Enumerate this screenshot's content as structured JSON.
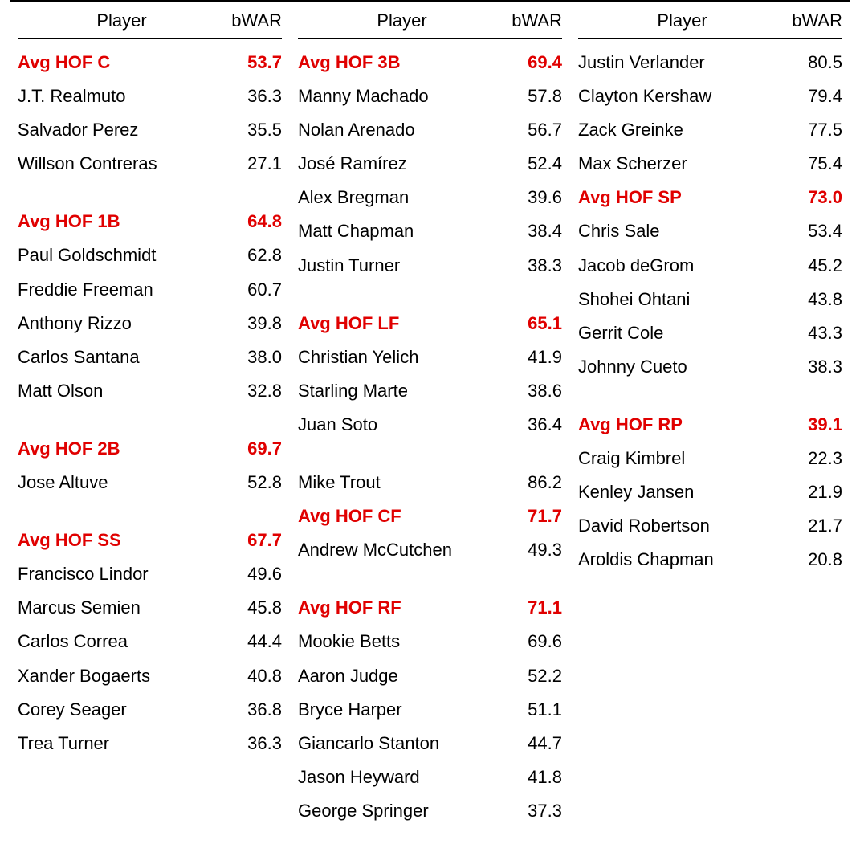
{
  "headers": {
    "player": "Player",
    "bwar": "bWAR"
  },
  "columns": [
    [
      {
        "type": "hof",
        "player": "Avg HOF C",
        "bwar": "53.7"
      },
      {
        "type": "row",
        "player": "J.T. Realmuto",
        "bwar": "36.3"
      },
      {
        "type": "row",
        "player": "Salvador Perez",
        "bwar": "35.5"
      },
      {
        "type": "row",
        "player": "Willson Contreras",
        "bwar": "27.1"
      },
      {
        "type": "spacer"
      },
      {
        "type": "hof",
        "player": "Avg HOF 1B",
        "bwar": "64.8"
      },
      {
        "type": "row",
        "player": "Paul Goldschmidt",
        "bwar": "62.8"
      },
      {
        "type": "row",
        "player": "Freddie Freeman",
        "bwar": "60.7"
      },
      {
        "type": "row",
        "player": "Anthony Rizzo",
        "bwar": "39.8"
      },
      {
        "type": "row",
        "player": "Carlos Santana",
        "bwar": "38.0"
      },
      {
        "type": "row",
        "player": "Matt Olson",
        "bwar": "32.8"
      },
      {
        "type": "spacer"
      },
      {
        "type": "hof",
        "player": "Avg HOF 2B",
        "bwar": "69.7"
      },
      {
        "type": "row",
        "player": "Jose Altuve",
        "bwar": "52.8"
      },
      {
        "type": "spacer"
      },
      {
        "type": "hof",
        "player": "Avg HOF SS",
        "bwar": "67.7"
      },
      {
        "type": "row",
        "player": "Francisco Lindor",
        "bwar": "49.6"
      },
      {
        "type": "row",
        "player": "Marcus Semien",
        "bwar": "45.8"
      },
      {
        "type": "row",
        "player": "Carlos Correa",
        "bwar": "44.4"
      },
      {
        "type": "row",
        "player": "Xander Bogaerts",
        "bwar": "40.8"
      },
      {
        "type": "row",
        "player": "Corey Seager",
        "bwar": "36.8"
      },
      {
        "type": "row",
        "player": "Trea Turner",
        "bwar": "36.3"
      }
    ],
    [
      {
        "type": "hof",
        "player": "Avg HOF 3B",
        "bwar": "69.4"
      },
      {
        "type": "row",
        "player": "Manny Machado",
        "bwar": "57.8"
      },
      {
        "type": "row",
        "player": "Nolan Arenado",
        "bwar": "56.7"
      },
      {
        "type": "row",
        "player": "José Ramírez",
        "bwar": "52.4"
      },
      {
        "type": "row",
        "player": "Alex Bregman",
        "bwar": "39.6"
      },
      {
        "type": "row",
        "player": "Matt Chapman",
        "bwar": "38.4"
      },
      {
        "type": "row",
        "player": "Justin Turner",
        "bwar": "38.3"
      },
      {
        "type": "spacer"
      },
      {
        "type": "hof",
        "player": "Avg HOF LF",
        "bwar": "65.1"
      },
      {
        "type": "row",
        "player": "Christian Yelich",
        "bwar": "41.9"
      },
      {
        "type": "row",
        "player": "Starling Marte",
        "bwar": "38.6"
      },
      {
        "type": "row",
        "player": "Juan Soto",
        "bwar": "36.4"
      },
      {
        "type": "spacer"
      },
      {
        "type": "row",
        "player": "Mike Trout",
        "bwar": "86.2"
      },
      {
        "type": "hof",
        "player": "Avg HOF CF",
        "bwar": "71.7"
      },
      {
        "type": "row",
        "player": "Andrew McCutchen",
        "bwar": "49.3"
      },
      {
        "type": "spacer"
      },
      {
        "type": "hof",
        "player": "Avg HOF RF",
        "bwar": "71.1"
      },
      {
        "type": "row",
        "player": "Mookie Betts",
        "bwar": "69.6"
      },
      {
        "type": "row",
        "player": "Aaron Judge",
        "bwar": "52.2"
      },
      {
        "type": "row",
        "player": "Bryce Harper",
        "bwar": "51.1"
      },
      {
        "type": "row",
        "player": "Giancarlo Stanton",
        "bwar": "44.7"
      },
      {
        "type": "row",
        "player": "Jason Heyward",
        "bwar": "41.8"
      },
      {
        "type": "row",
        "player": "George Springer",
        "bwar": "37.3"
      }
    ],
    [
      {
        "type": "row",
        "player": "Justin Verlander",
        "bwar": "80.5"
      },
      {
        "type": "row",
        "player": "Clayton Kershaw",
        "bwar": "79.4"
      },
      {
        "type": "row",
        "player": "Zack Greinke",
        "bwar": "77.5"
      },
      {
        "type": "row",
        "player": "Max Scherzer",
        "bwar": "75.4"
      },
      {
        "type": "hof",
        "player": "Avg HOF SP",
        "bwar": "73.0"
      },
      {
        "type": "row",
        "player": "Chris Sale",
        "bwar": "53.4"
      },
      {
        "type": "row",
        "player": "Jacob deGrom",
        "bwar": "45.2"
      },
      {
        "type": "row",
        "player": "Shohei Ohtani",
        "bwar": "43.8"
      },
      {
        "type": "row",
        "player": "Gerrit Cole",
        "bwar": "43.3"
      },
      {
        "type": "row",
        "player": "Johnny Cueto",
        "bwar": "38.3"
      },
      {
        "type": "spacer"
      },
      {
        "type": "hof",
        "player": "Avg HOF RP",
        "bwar": "39.1"
      },
      {
        "type": "row",
        "player": "Craig Kimbrel",
        "bwar": "22.3"
      },
      {
        "type": "row",
        "player": "Kenley Jansen",
        "bwar": "21.9"
      },
      {
        "type": "row",
        "player": "David Robertson",
        "bwar": "21.7"
      },
      {
        "type": "row",
        "player": "Aroldis Chapman",
        "bwar": "20.8"
      }
    ]
  ]
}
